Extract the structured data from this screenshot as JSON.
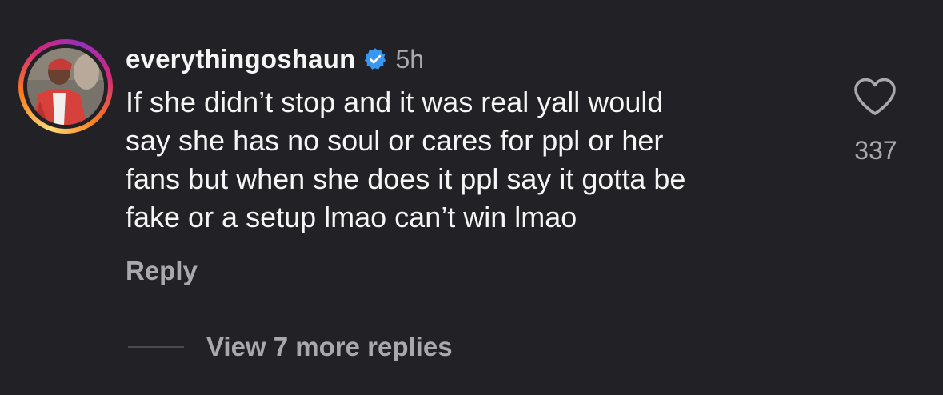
{
  "comment": {
    "username": "everythingoshaun",
    "verified": true,
    "timestamp": "5h",
    "text_lines": [
      "If she didn’t stop and it was real yall would",
      "say she has no soul or cares for ppl or her",
      "fans but when she does it ppl say it gotta be",
      "fake or a setup lmao can’t win lmao"
    ],
    "reply_label": "Reply",
    "like_count": "337",
    "view_more_label": "View 7 more replies",
    "has_story_ring": true
  },
  "colors": {
    "background": "#212126",
    "primary_text": "#f5f5f5",
    "secondary_text": "#a8a8ad",
    "verified_badge": "#3897f0",
    "story_ring": [
      "#feda75",
      "#fa7e1e",
      "#d62976",
      "#962fbf"
    ]
  },
  "icons": {
    "verified": "verified-badge-icon",
    "like": "heart-outline-icon"
  }
}
